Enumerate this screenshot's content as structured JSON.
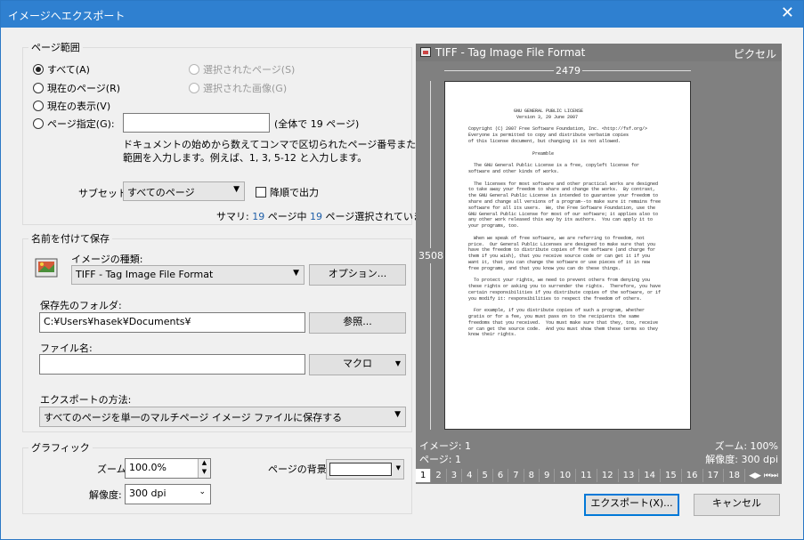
{
  "window": {
    "title": "イメージへエクスポート",
    "close_glyph": "✕"
  },
  "pages": {
    "legend": "ページ範囲",
    "all": "すべて(A)",
    "current_page": "現在のページ(R)",
    "current_view": "現在の表示(V)",
    "specify": "ページ指定(G):",
    "selected_pages": "選択されたページ(S)",
    "selected_images": "選択された画像(G)",
    "range_value": "",
    "total_text": "(全体で 19 ページ)",
    "help_line1": "ドキュメントの始めから数えてコンマで区切られたページ番号またはページ",
    "help_line2": "範囲を入力します。例えば、1, 3, 5-12 と入力します。",
    "subset_label": "サブセット:",
    "subset_value": "すべてのページ",
    "reverse_label": "降順で出力",
    "summary_prefix": "サマリ: ",
    "summary_n1": "19",
    "summary_mid": " ページ中 ",
    "summary_n2": "19",
    "summary_suffix": " ページ選択されています"
  },
  "save": {
    "legend": "名前を付けて保存",
    "type_label": "イメージの種類:",
    "type_value": "TIFF - Tag Image File Format",
    "options_button": "オプション...",
    "folder_label": "保存先のフォルダ:",
    "folder_value": "C:¥Users¥hasek¥Documents¥",
    "browse_button": "参照...",
    "filename_label": "ファイル名:",
    "filename_value": "",
    "macro_button": "マクロ",
    "method_label": "エクスポートの方法:",
    "method_value": "すべてのページを単一のマルチページ イメージ ファイルに保存する"
  },
  "graphic": {
    "legend": "グラフィック",
    "zoom_label": "ズーム:",
    "zoom_value": "100.0%",
    "dpi_label": "解像度:",
    "dpi_value": "300 dpi",
    "bg_label": "ページの背景:"
  },
  "preview": {
    "format": "TIFF - Tag Image File Format",
    "unit": "ピクセル",
    "width": "2479",
    "height": "3508",
    "image_info": "イメージ: 1",
    "page_info": "ページ: 1",
    "zoom_info": "ズーム: 100%",
    "dpi_info": "解像度: 300 dpi",
    "page_text": "                 GNU GENERAL PUBLIC LICENSE\n                  Version 3, 29 June 2007\n\nCopyright (C) 2007 Free Software Foundation, Inc. <http://fsf.org/>\nEveryone is permitted to copy and distribute verbatim copies\nof this license document, but changing it is not allowed.\n\n                        Preamble\n\n  The GNU General Public License is a free, copyleft license for\nsoftware and other kinds of works.\n\n  The licenses for most software and other practical works are designed\nto take away your freedom to share and change the works.  By contrast,\nthe GNU General Public License is intended to guarantee your freedom to\nshare and change all versions of a program--to make sure it remains free\nsoftware for all its users.  We, the Free Software Foundation, use the\nGNU General Public License for most of our software; it applies also to\nany other work released this way by its authors.  You can apply it to\nyour programs, too.\n\n  When we speak of free software, we are referring to freedom, not\nprice.  Our General Public Licenses are designed to make sure that you\nhave the freedom to distribute copies of free software (and charge for\nthem if you wish), that you receive source code or can get it if you\nwant it, that you can change the software or use pieces of it in new\nfree programs, and that you know you can do these things.\n\n  To protect your rights, we need to prevent others from denying you\nthese rights or asking you to surrender the rights.  Therefore, you have\ncertain responsibilities if you distribute copies of the software, or if\nyou modify it: responsibilities to respect the freedom of others.\n\n  For example, if you distribute copies of such a program, whether\ngratis or for a fee, you must pass on to the recipients the same\nfreedoms that you received.  You must make sure that they, too, receive\nor can get the source code.  And you must show them these terms so they\nknow their rights."
  },
  "pager": {
    "pages": [
      "1",
      "2",
      "3",
      "4",
      "5",
      "6",
      "7",
      "8",
      "9",
      "10",
      "11",
      "12",
      "13",
      "14",
      "15",
      "16",
      "17",
      "18"
    ],
    "active": "1"
  },
  "footer": {
    "export_button": "エクスポート(X)...",
    "cancel_button": "キャンセル"
  },
  "icons": {
    "close": "close-icon",
    "tiff": "tiff-file-icon",
    "save": "image-save-icon"
  },
  "colors": {
    "title_bar": "#2f80d0",
    "preview_bg": "#808080",
    "link_number": "#1f5fa8"
  }
}
